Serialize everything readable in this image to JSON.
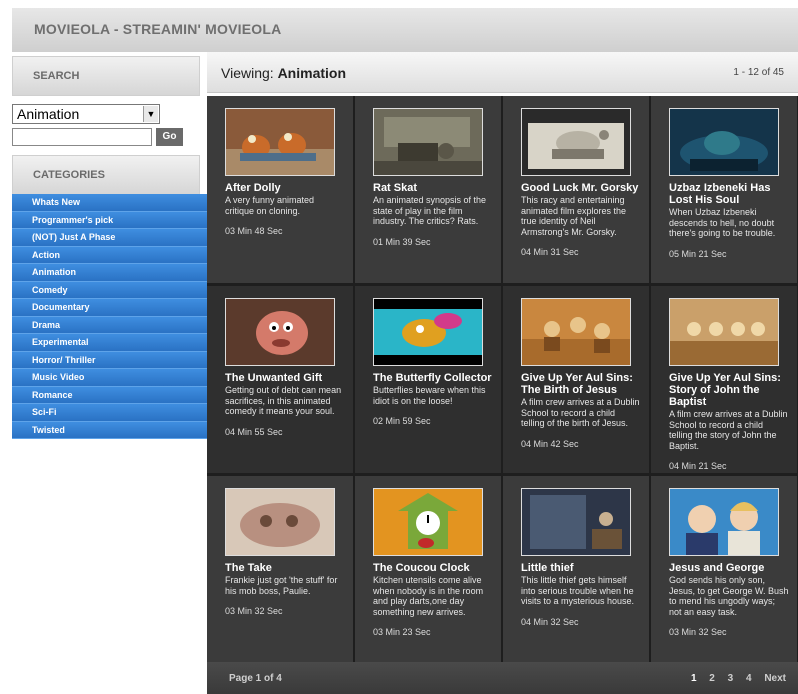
{
  "app": {
    "title": "MOVIEOLA - STREAMIN' MOVIEOLA"
  },
  "sidebar": {
    "search_heading": "SEARCH",
    "selected_category": "Animation",
    "search_value": "",
    "go_label": "Go",
    "categories_heading": "CATEGORIES",
    "categories": [
      "Whats New",
      "Programmer's pick",
      "(NOT) Just A Phase",
      "Action",
      "Animation",
      "Comedy",
      "Documentary",
      "Drama",
      "Experimental",
      "Horror/ Thriller",
      "Music Video",
      "Romance",
      "Sci-Fi",
      "Twisted"
    ]
  },
  "main": {
    "viewing_prefix": "Viewing:",
    "viewing_category": "Animation",
    "range": "1 - 12 of 45"
  },
  "movies": [
    {
      "title": "After Dolly",
      "desc": "A very funny animated critique on cloning.",
      "duration": "03 Min 48 Sec"
    },
    {
      "title": "Rat Skat",
      "desc": "An animated synopsis of the state of play in the film industry. The critics? Rats.",
      "duration": "01 Min 39 Sec"
    },
    {
      "title": "Good Luck Mr. Gorsky",
      "desc": "This racy and entertaining animated film explores the true identity of Neil Armstrong's Mr. Gorsky.",
      "duration": "04 Min 31 Sec"
    },
    {
      "title": "Uzbaz Izbeneki Has Lost His Soul",
      "desc": "When Uzbaz Izbeneki descends to hell, no doubt there's going to be trouble.",
      "duration": "05 Min 21 Sec"
    },
    {
      "title": "The Unwanted Gift",
      "desc": "Getting out of debt can mean sacrifices, in this animated comedy it means your soul.",
      "duration": "04 Min 55 Sec"
    },
    {
      "title": "The Butterfly Collector",
      "desc": "Butterflies beware when this idiot is on the loose!",
      "duration": "02 Min 59 Sec"
    },
    {
      "title": "Give Up Yer Aul Sins: The Birth of Jesus",
      "desc": "A film crew arrives at a Dublin School to record a child telling of the birth of Jesus.",
      "duration": "04 Min 42 Sec"
    },
    {
      "title": "Give Up Yer Aul Sins: Story of John the Baptist",
      "desc": "A film crew arrives at a Dublin School to record a child telling the story of John the Baptist.",
      "duration": "04 Min 21 Sec"
    },
    {
      "title": "The Take",
      "desc": "Frankie just got 'the stuff' for his mob boss, Paulie.",
      "duration": "03 Min 32 Sec"
    },
    {
      "title": "The Coucou Clock",
      "desc": "Kitchen utensils come alive when nobody is in the room and play darts,one day something new arrives.",
      "duration": "03 Min 23 Sec"
    },
    {
      "title": "Little thief",
      "desc": "This little thief gets himself into serious trouble when he visits to a mysterious house.",
      "duration": "04 Min 32 Sec"
    },
    {
      "title": "Jesus and George",
      "desc": "God sends his only son, Jesus, to get George W. Bush to mend his ungodly ways; not an easy task.",
      "duration": "03 Min 32 Sec"
    }
  ],
  "footer": {
    "page_label": "Page 1 of 4",
    "pages": [
      "1",
      "2",
      "3",
      "4"
    ],
    "next_label": "Next"
  }
}
